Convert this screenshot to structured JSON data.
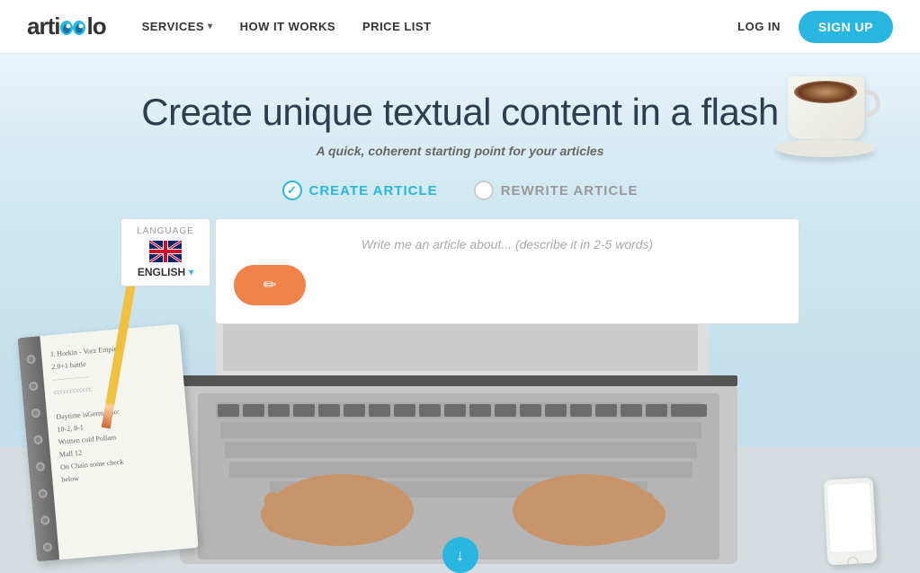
{
  "brand": {
    "name_part1": "arti",
    "name_eyes": "oo",
    "name_part2": "lo"
  },
  "navbar": {
    "services_label": "SERVICES",
    "how_it_works_label": "HOW IT WORKS",
    "price_list_label": "PRICE LIST",
    "login_label": "LOG IN",
    "signup_label": "SIGN UP"
  },
  "hero": {
    "title_line1": "Create unique textual content in a flash",
    "subtitle": "A quick, coherent starting point for your articles",
    "option1_label": "CREATE ARTICLE",
    "option2_label": "REWRITE ARTICLE"
  },
  "form": {
    "language_label": "LANGUAGE",
    "language_value": "ENGLISH",
    "input_placeholder": "Write me an article about... (describe it in 2-5 words)",
    "write_button_icon": "✏"
  },
  "notebook": {
    "lines": [
      "J. Horkin - Vorz Empire",
      "2.0+1 battle",
      "~~~~~",
      "cccccccccccc",
      "",
      "Daytime isGermando: 10-2, 8-1",
      "Written cold Pollam Mall 12",
      "On Chain some check below"
    ]
  },
  "download_arrow": "↓",
  "colors": {
    "accent_blue": "#29b6e0",
    "accent_orange": "#f0834a",
    "text_dark": "#2c3e50",
    "text_gray": "#666666"
  }
}
